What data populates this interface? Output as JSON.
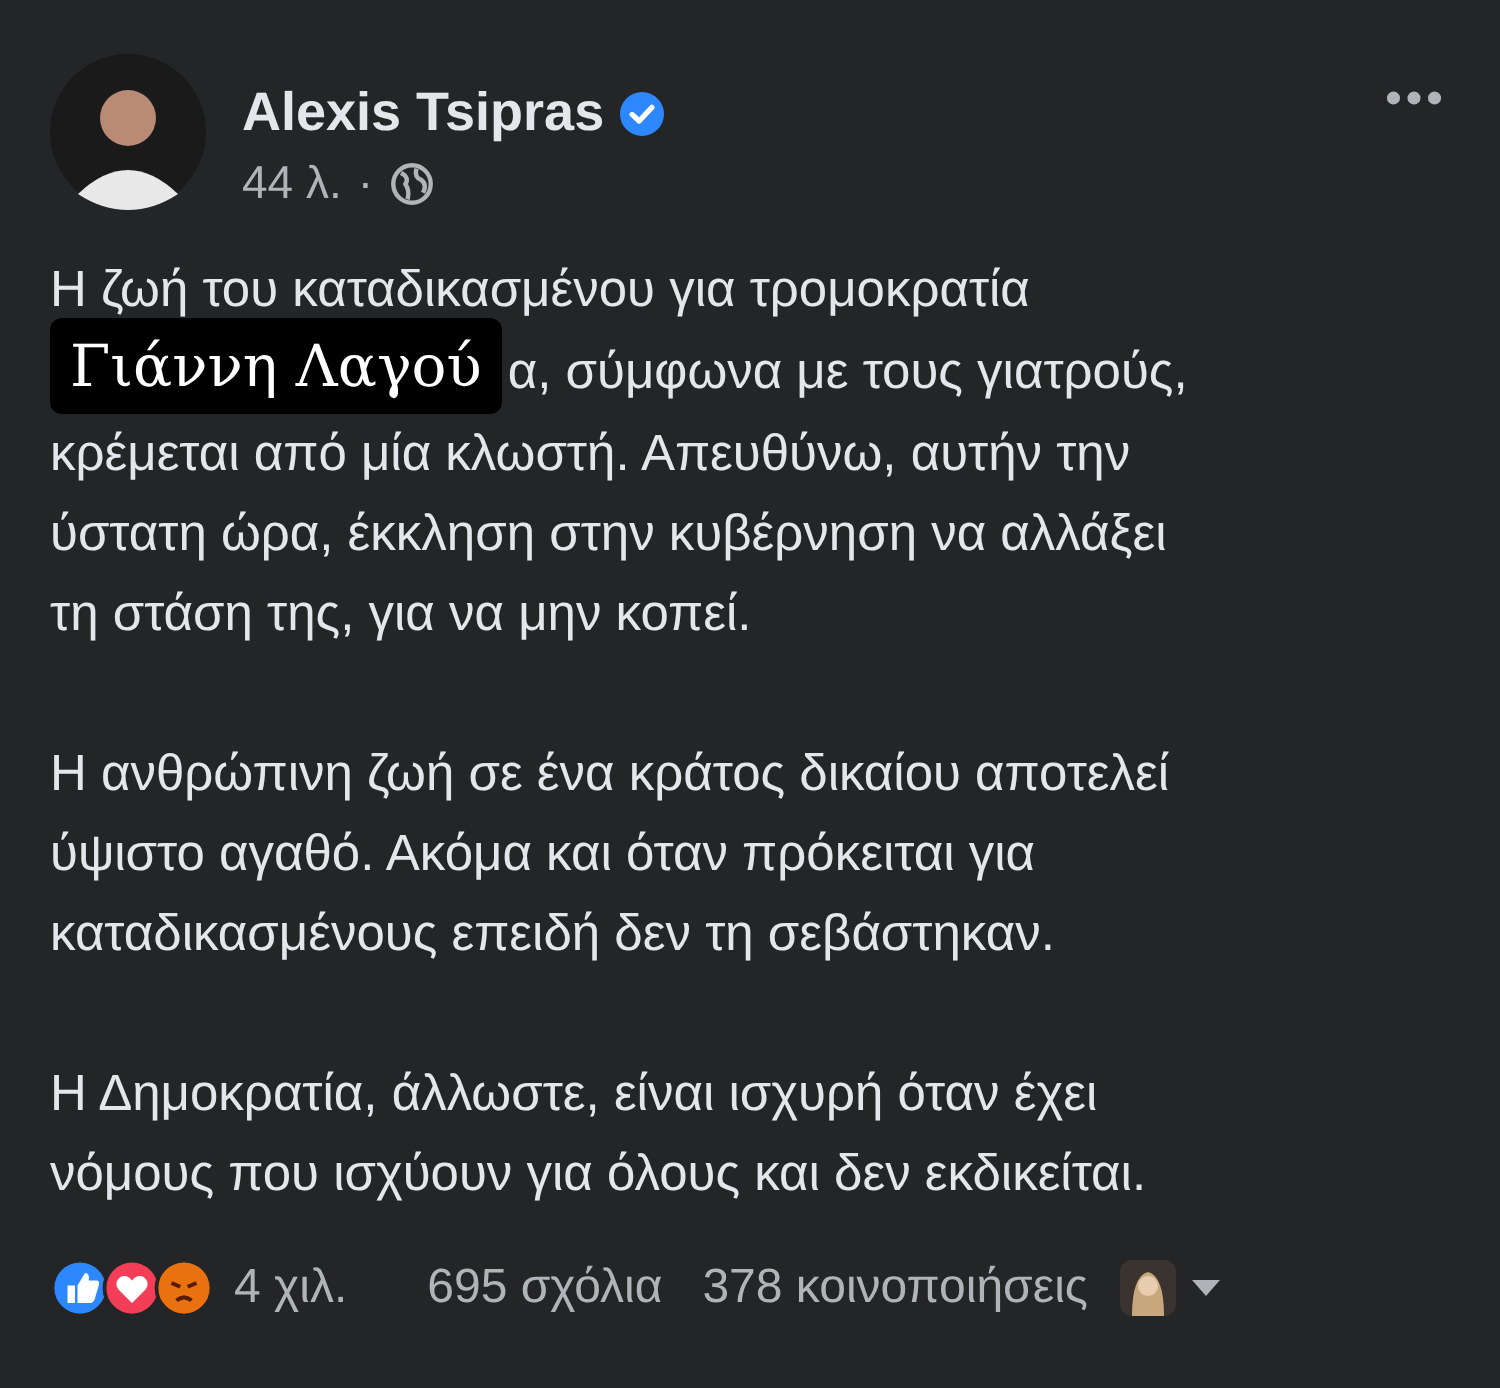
{
  "post": {
    "author": "Alexis Tsipras",
    "verified": true,
    "time": "44 λ.",
    "separator": "·"
  },
  "body": [
    {
      "kind": "text",
      "text": "Η ζωή του καταδικασμένου για τρομοκρατία"
    },
    {
      "kind": "tagged",
      "label": "Γιάννη Λαγού",
      "text": "α, σύμφωνα με τους γιατρούς,"
    },
    {
      "kind": "text",
      "text": "κρέμεται από μία κλωστή. Απευθύνω, αυτήν την\nύστατη ώρα, έκκληση στην κυβέρνηση να αλλάξει\nτη στάση της, για να μην κοπεί."
    },
    {
      "kind": "paragraph",
      "text": "Η ανθρώπινη ζωή σε ένα κράτος δικαίου αποτελεί\nύψιστο αγαθό. Ακόμα και όταν πρόκειται για\nκαταδικασμένους επειδή δεν τη σεβάστηκαν."
    },
    {
      "kind": "paragraph",
      "text": "Η Δημοκρατία, άλλωστε, είναι ισχυρή όταν έχει\nνόμους που ισχύουν για όλους και δεν εκδικείται."
    }
  ],
  "footer": {
    "reactions": "4 χιλ.",
    "comments": "695 σχόλια",
    "shares": "378 κοινοποιήσεις"
  }
}
